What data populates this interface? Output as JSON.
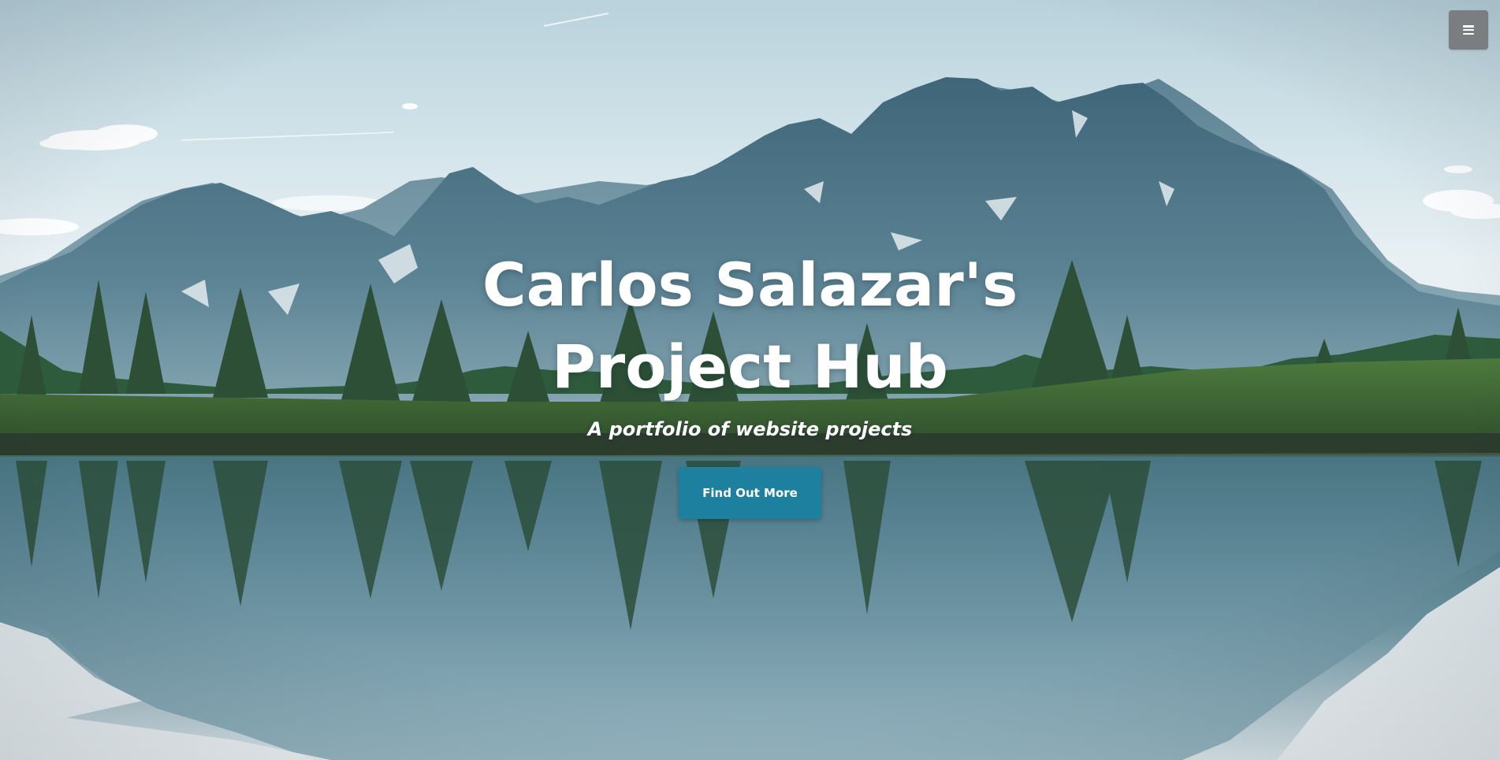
{
  "header": {
    "menu_icon": "hamburger-menu-icon"
  },
  "hero": {
    "title_line1": "Carlos Salazar's",
    "title_line2": "Project Hub",
    "subtitle": "A portfolio of website projects",
    "cta_label": "Find Out More"
  },
  "colors": {
    "cta_background": "#1d809f",
    "menu_toggle_background": "#7b7e81",
    "text": "#ffffff"
  }
}
